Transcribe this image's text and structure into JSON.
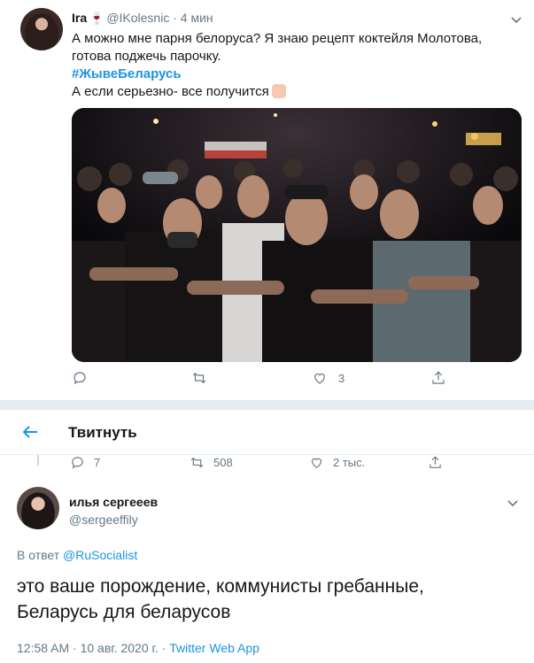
{
  "tweet1": {
    "author_name": "Ira",
    "author_glass": "🍷",
    "handle": "@IKolesnic",
    "separator": "·",
    "time": "4 мин",
    "lines": [
      "А можно мне парня белоруса? Я знаю рецепт коктейля Молотова,",
      "готова поджечь парочку."
    ],
    "hashtag": "#ЖывеБеларусь",
    "line_last": "А если серьезно- все получится",
    "likes": "3"
  },
  "header": {
    "title": "Твитнуть"
  },
  "parent_stats": {
    "replies": "7",
    "retweets": "508",
    "likes": "2 тыс."
  },
  "tweet2": {
    "author_name": "илья сергееев",
    "handle": "@sergeeffily",
    "reply_prefix": "В ответ",
    "reply_to": "@RuSocialist",
    "body_lines": [
      "это ваше порождение, коммунисты гребанные,",
      "Беларусь для беларусов"
    ],
    "timestamp": "12:58 AM · 10 авг. 2020 г. ·",
    "source": "Twitter Web App"
  },
  "colors": {
    "accent": "#1b95e0",
    "muted": "#657786",
    "separator": "#e6ecf0"
  }
}
